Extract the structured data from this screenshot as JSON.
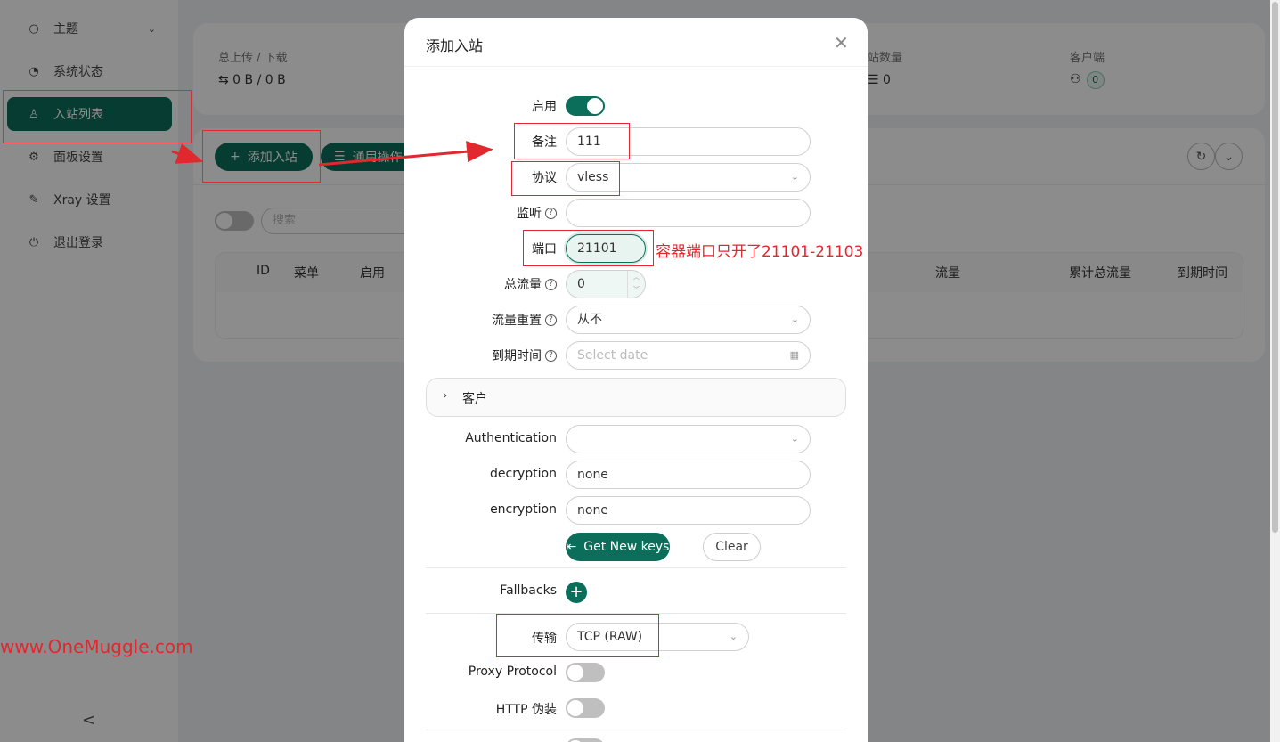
{
  "sidebar": {
    "items": [
      {
        "label": "主题",
        "icon": "bulb-icon",
        "glyph": "💡"
      },
      {
        "label": "系统状态",
        "icon": "dashboard-icon",
        "glyph": "◔"
      },
      {
        "label": "入站列表",
        "icon": "user-icon",
        "glyph": "♙",
        "active": true
      },
      {
        "label": "面板设置",
        "icon": "gear-icon",
        "glyph": "⚙"
      },
      {
        "label": "Xray 设置",
        "icon": "wrench-icon",
        "glyph": "🔧"
      },
      {
        "label": "退出登录",
        "icon": "logout-icon",
        "glyph": "⏻"
      }
    ],
    "collapse_glyph": "<"
  },
  "stats": {
    "traffic_label": "总上传 / 下载",
    "traffic_value": "⇆ 0 B / 0 B",
    "inbound_count_label": "站数量",
    "inbound_count_value": "☰ 0",
    "clients_label": "客户端",
    "clients_value": "0"
  },
  "toolbar": {
    "add_inbound": "添加入站",
    "general_actions": "通用操作",
    "search_placeholder": "搜索"
  },
  "table": {
    "headers": [
      "ID",
      "菜单",
      "启用",
      "流量",
      "累计总流量",
      "到期时间"
    ]
  },
  "modal": {
    "title": "添加入站",
    "fields": {
      "enable_label": "启用",
      "remark_label": "备注",
      "remark_value": "111",
      "protocol_label": "协议",
      "protocol_value": "vless",
      "listen_label": "监听",
      "listen_value": "",
      "port_label": "端口",
      "port_value": "21101",
      "total_traffic_label": "总流量",
      "total_traffic_value": "0",
      "traffic_reset_label": "流量重置",
      "traffic_reset_value": "从不",
      "expiry_label": "到期时间",
      "expiry_placeholder": "Select date",
      "clients_panel": "客户",
      "authentication_label": "Authentication",
      "authentication_value": "",
      "decryption_label": "decryption",
      "decryption_value": "none",
      "encryption_label": "encryption",
      "encryption_value": "none",
      "get_keys": "Get New keys",
      "clear": "Clear",
      "fallbacks_label": "Fallbacks",
      "transport_label": "传输",
      "transport_value": "TCP (RAW)",
      "proxy_protocol_label": "Proxy Protocol",
      "http_camouflage_label": "HTTP 伪装"
    },
    "toggles": {
      "enable": true,
      "proxy_protocol": false,
      "http_camouflage": false
    }
  },
  "annotations": {
    "port_note": "容器端口只开了21101-21103",
    "watermark": "www.OneMuggle.com"
  },
  "colors": {
    "accent": "#0b6e5a",
    "annotation": "#e0282e"
  }
}
